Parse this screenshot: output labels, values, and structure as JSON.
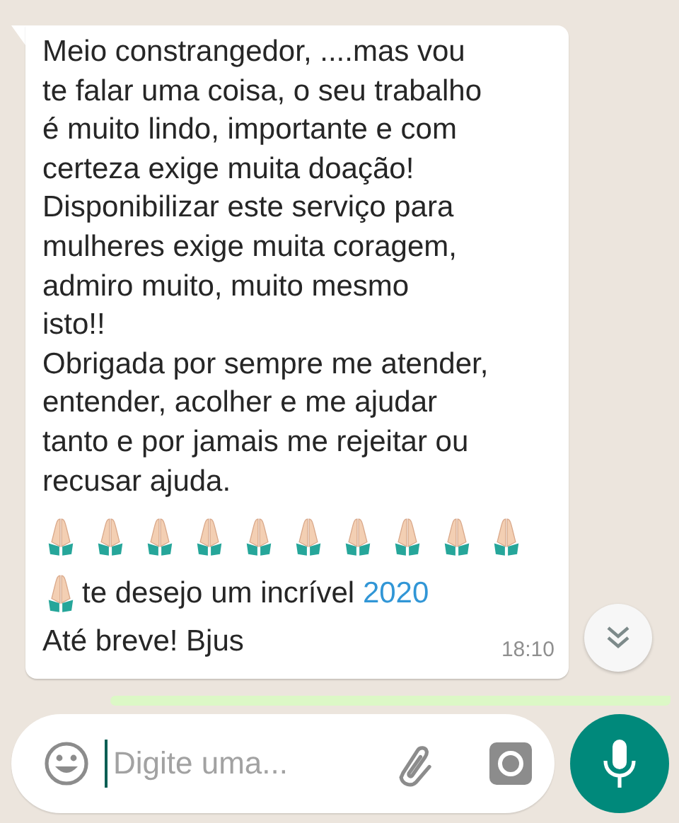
{
  "message": {
    "paragraphs": [
      {
        "lines": [
          "Meio constrangedor, ....mas vou",
          "te falar uma coisa, o seu trabalho",
          "é muito lindo, importante e com",
          "certeza exige muita doação!"
        ]
      },
      {
        "lines": [
          "Disponibilizar este serviço para",
          "mulheres exige muita coragem,",
          "admiro muito, muito mesmo",
          "isto!!"
        ]
      },
      {
        "lines": [
          "Obrigada por sempre me atender,",
          "entender, acolher e me ajudar",
          "tanto e por jamais me rejeitar ou",
          "recusar ajuda."
        ]
      }
    ],
    "emoji_row": [
      {
        "kind": "praying-hands"
      },
      {
        "kind": "praying-hands"
      },
      {
        "kind": "praying-hands"
      },
      {
        "kind": "praying-hands"
      },
      {
        "kind": "praying-hands"
      },
      {
        "kind": "praying-hands"
      },
      {
        "kind": "praying-hands"
      },
      {
        "kind": "praying-hands"
      },
      {
        "kind": "praying-hands"
      },
      {
        "kind": "praying-hands"
      }
    ],
    "wish": {
      "emoji": {
        "kind": "praying-hands"
      },
      "text": "te desejo um incrível ",
      "link": "2020"
    },
    "closing": "Até breve! Bjus",
    "time": "18:10"
  },
  "composer": {
    "placeholder": "Digite uma..."
  }
}
